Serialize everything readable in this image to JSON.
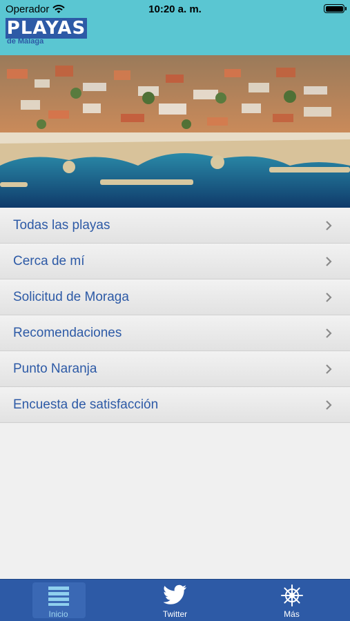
{
  "status_bar": {
    "carrier": "Operador",
    "time": "10:20 a. m."
  },
  "logo": {
    "main": "PLAYAS",
    "sub": "de Málaga"
  },
  "menu": {
    "items": [
      {
        "label": "Todas las playas"
      },
      {
        "label": "Cerca de mí"
      },
      {
        "label": "Solicitud de Moraga"
      },
      {
        "label": "Recomendaciones"
      },
      {
        "label": "Punto Naranja"
      },
      {
        "label": "Encuesta de satisfacción"
      }
    ]
  },
  "tabbar": {
    "tabs": [
      {
        "label": "Inicio",
        "icon": "list-icon",
        "active": true
      },
      {
        "label": "Twitter",
        "icon": "twitter-icon",
        "active": false
      },
      {
        "label": "Más",
        "icon": "ship-wheel-icon",
        "active": false
      }
    ]
  },
  "colors": {
    "header": "#5ac6d2",
    "brand_blue": "#2d5aa6",
    "menu_text": "#2d5aa6"
  }
}
